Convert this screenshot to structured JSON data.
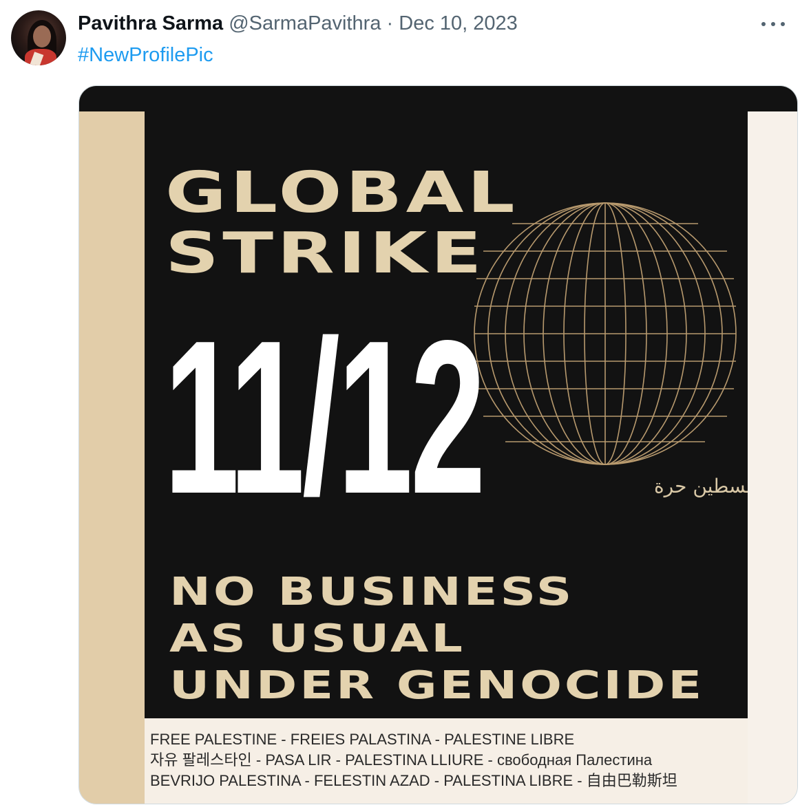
{
  "tweet": {
    "author_name": "Pavithra Sarma",
    "author_handle": "@SarmaPavithra",
    "separator": "·",
    "date": "Dec 10, 2023",
    "more_icon": "more-horizontal-icon",
    "hashtag": "#NewProfilePic"
  },
  "poster": {
    "title_lines": [
      "GLOBAL",
      "STRIKE"
    ],
    "date": "11/12",
    "arabic": "فلسطين حرة",
    "slogan_lines": [
      "NO BUSINESS",
      "AS USUAL",
      "UNDER GENOCIDE"
    ],
    "translation_lines": [
      "FREE PALESTINE  -  FREIES PALASTINA  -  PALESTINE LIBRE",
      "자유 팔레스타인 - PASA LIR - PALESTINA LLIURE - свободная Палестина",
      "BEVRIJO PALESTINA - FELESTIN AZAD - PALESTINA LIBRE  -  自由巴勒斯坦"
    ]
  },
  "colors": {
    "poster_bg": "#121212",
    "beige": "#e3d2ae",
    "link": "#1d9bf0",
    "secondary_text": "#536471"
  }
}
